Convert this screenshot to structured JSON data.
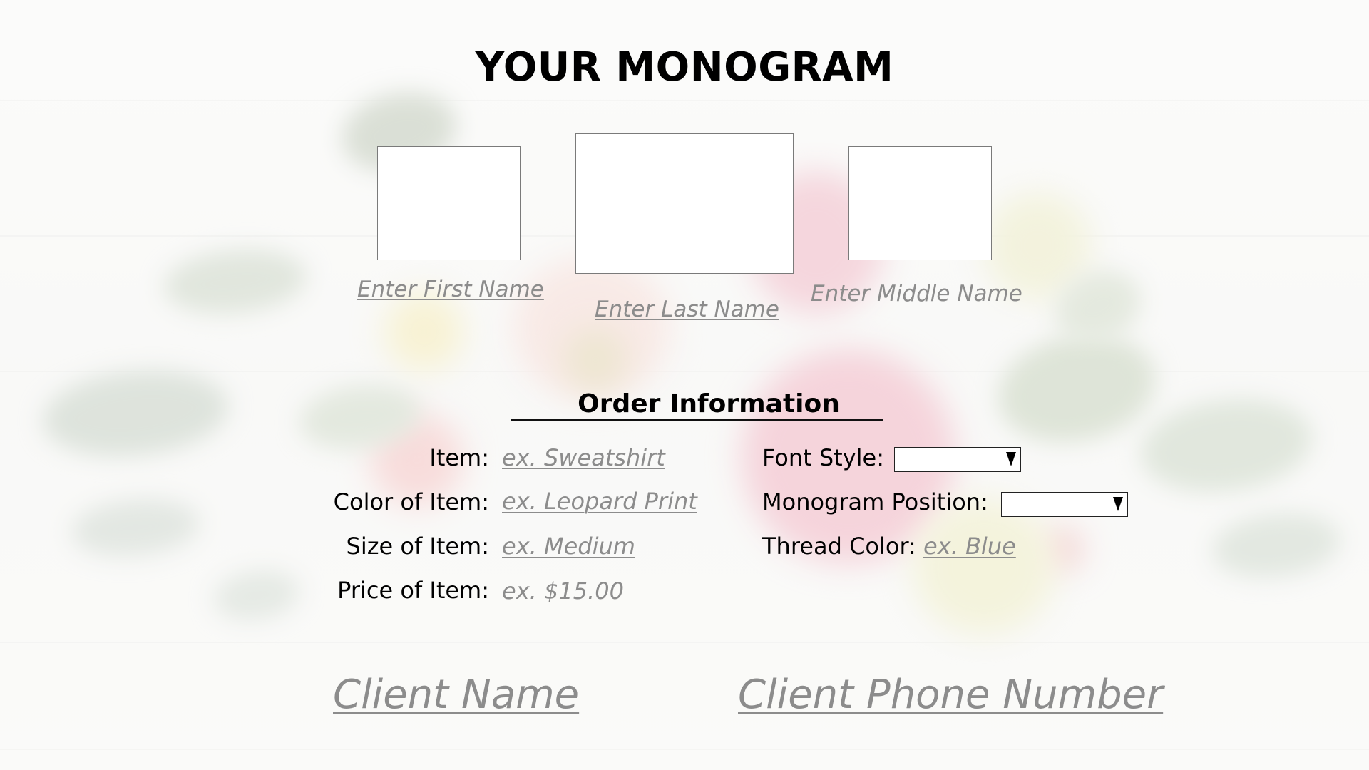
{
  "page": {
    "title": "YOUR MONOGRAM"
  },
  "monogram": {
    "first_name_placeholder": "Enter First Name",
    "last_name_placeholder": "Enter Last Name",
    "middle_name_placeholder": "Enter Middle Name"
  },
  "order": {
    "section_title": "Order Information",
    "item_label": "Item:",
    "item_placeholder": "ex. Sweatshirt",
    "color_label": "Color of Item:",
    "color_placeholder": "ex. Leopard Print",
    "size_label": "Size of Item:",
    "size_placeholder": "ex. Medium",
    "price_label": "Price of Item:",
    "price_placeholder": "ex. $15.00",
    "font_style_label": "Font Style:",
    "font_style_value": "",
    "position_label": "Monogram Position:",
    "position_value": "",
    "thread_label": "Thread Color:",
    "thread_placeholder": "ex. Blue"
  },
  "client": {
    "name_placeholder": "Client Name",
    "phone_placeholder": "Client Phone Number"
  },
  "colors": {
    "placeholder_text": "#8c8c8c",
    "text": "#000000",
    "box_fill": "#ffffff"
  },
  "icons": {
    "dropdown_arrow": "dropdown-arrow-icon"
  }
}
